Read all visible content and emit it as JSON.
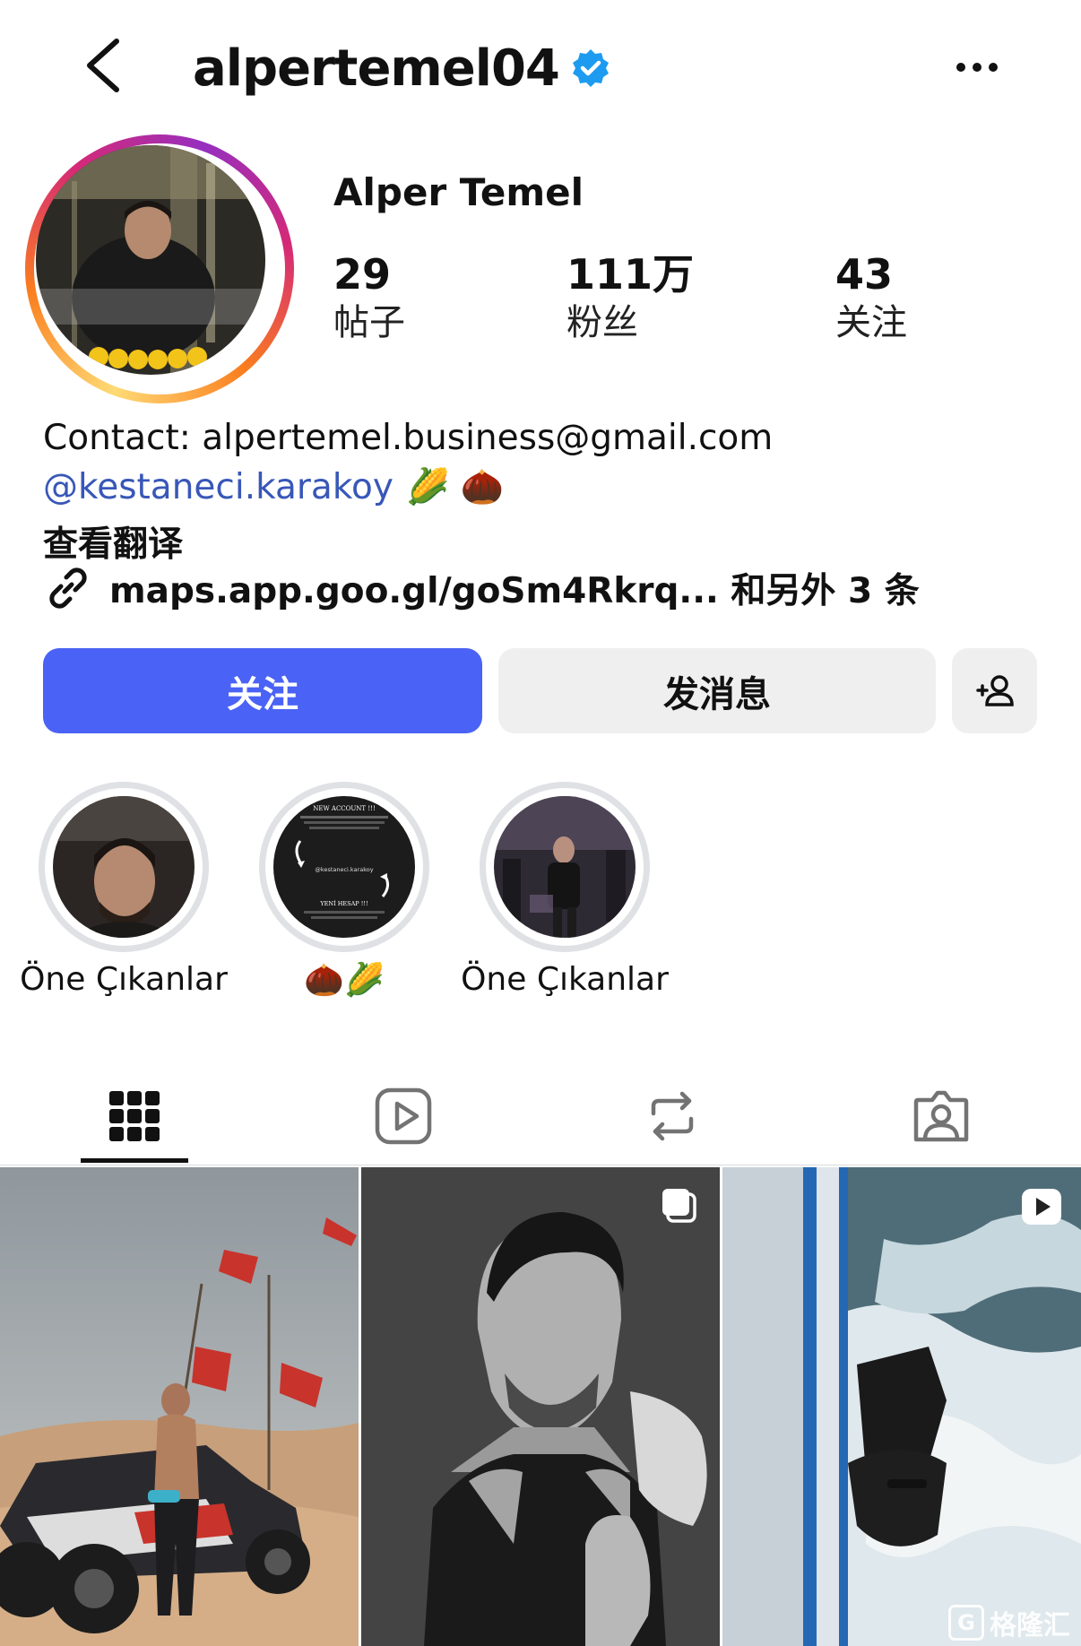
{
  "header": {
    "username": "alpertemel04",
    "verified_icon": "verified-badge-icon",
    "back_icon": "chevron-left-icon",
    "more_icon": "more-horizontal-icon"
  },
  "profile": {
    "full_name": "Alper Temel",
    "stats": [
      {
        "value": "29",
        "label": "帖子"
      },
      {
        "value": "111万",
        "label": "粉丝"
      },
      {
        "value": "43",
        "label": "关注"
      }
    ]
  },
  "bio": {
    "contact": "Contact: alpertemel.business@gmail.com",
    "mention": "@kestaneci.karakoy",
    "mention_emojis": "🌽 🌰",
    "see_translation": "查看翻译",
    "link_text": "maps.app.goo.gl/goSm4Rkrq... 和另外 3 条"
  },
  "actions": {
    "follow_label": "关注",
    "message_label": "发消息",
    "add_user_icon": "add-user-icon",
    "colors": {
      "follow_bg": "#4a62f5",
      "secondary_bg": "#efefef"
    }
  },
  "highlights": [
    {
      "label": "Öne Çıkanlar"
    },
    {
      "label": "🌰🌽"
    },
    {
      "label": "Öne Çıkanlar"
    }
  ],
  "highlight_story_text": {
    "title": "NEW ACCOUNT !!!",
    "handle": "@kestaneci.karakoy",
    "subtitle": "YENİ HESAP !!!"
  },
  "tabs": [
    {
      "icon": "grid-icon",
      "active": true
    },
    {
      "icon": "reels-icon",
      "active": false
    },
    {
      "icon": "reposts-icon",
      "active": false
    },
    {
      "icon": "tagged-icon",
      "active": false
    }
  ],
  "posts": [
    {
      "type": "photo",
      "badge": ""
    },
    {
      "type": "carousel",
      "badge": "carousel-icon"
    },
    {
      "type": "reel",
      "badge": "reel-icon"
    }
  ],
  "watermark": {
    "logo": "G",
    "text": "格隆汇"
  }
}
